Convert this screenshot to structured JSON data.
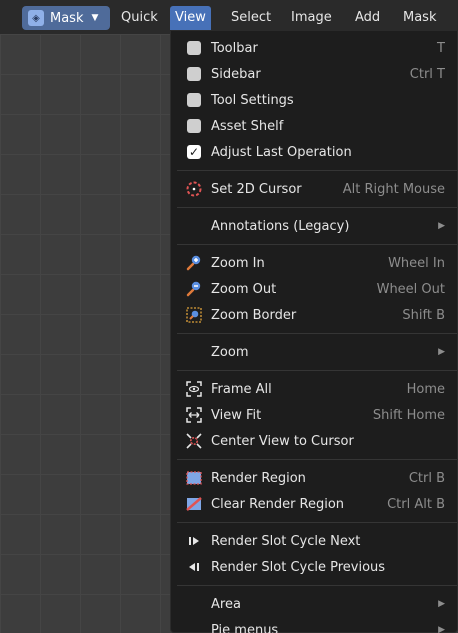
{
  "header": {
    "mode_label": "Mask",
    "menus": [
      "Quick",
      "View",
      "Select",
      "Image",
      "Add",
      "Mask"
    ]
  },
  "menu": {
    "items": {
      "toolbar": {
        "label": "Toolbar",
        "shortcut": "T"
      },
      "sidebar": {
        "label": "Sidebar",
        "shortcut": "Ctrl T"
      },
      "tool_settings": {
        "label": "Tool Settings"
      },
      "asset_shelf": {
        "label": "Asset Shelf"
      },
      "adjust_last_operation": {
        "label": "Adjust Last Operation"
      },
      "set_2d_cursor": {
        "label": "Set 2D Cursor",
        "shortcut": "Alt Right Mouse"
      },
      "annotations": {
        "label": "Annotations (Legacy)"
      },
      "zoom_in": {
        "label": "Zoom In",
        "shortcut": "Wheel In"
      },
      "zoom_out": {
        "label": "Zoom Out",
        "shortcut": "Wheel Out"
      },
      "zoom_border": {
        "label": "Zoom Border",
        "shortcut": "Shift B"
      },
      "zoom": {
        "label": "Zoom"
      },
      "frame_all": {
        "label": "Frame All",
        "shortcut": "Home"
      },
      "view_fit": {
        "label": "View Fit",
        "shortcut": "Shift Home"
      },
      "center_view": {
        "label": "Center View to Cursor"
      },
      "render_region": {
        "label": "Render Region",
        "shortcut": "Ctrl B"
      },
      "clear_render_region": {
        "label": "Clear Render Region",
        "shortcut": "Ctrl Alt B"
      },
      "slot_next": {
        "label": "Render Slot Cycle Next"
      },
      "slot_prev": {
        "label": "Render Slot Cycle Previous"
      },
      "area": {
        "label": "Area"
      },
      "pie_menus": {
        "label": "Pie menus"
      }
    },
    "checkbox_states": {
      "toolbar": false,
      "sidebar": false,
      "tool_settings": false,
      "asset_shelf": false,
      "adjust_last_operation": true
    }
  },
  "colors": {
    "accent": "#4771b8",
    "menu_bg": "#1d1d1d",
    "header_bg": "#2a2a2a",
    "viewport_bg": "#3d3d3d"
  }
}
